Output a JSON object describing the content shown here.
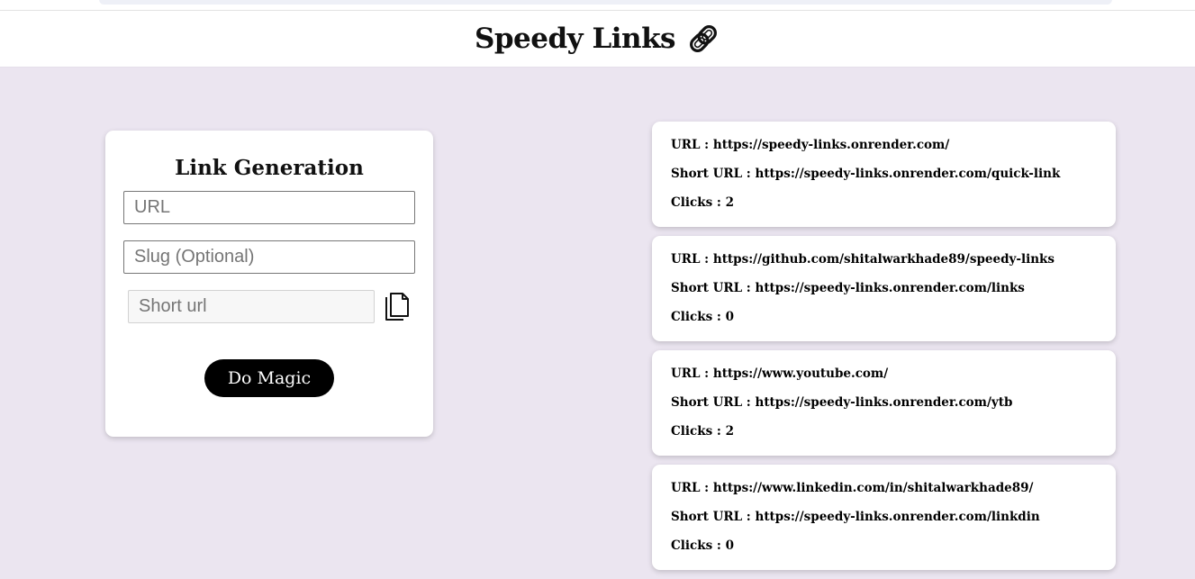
{
  "header": {
    "title": "Speedy Links",
    "icon": "link-icon"
  },
  "form": {
    "title": "Link Generation",
    "url_placeholder": "URL",
    "slug_placeholder": "Slug (Optional)",
    "short_placeholder": "Short url",
    "copy_icon": "copy-icon",
    "submit_label": "Do Magic"
  },
  "labels": {
    "url": "URL : ",
    "short_url": "Short URL : ",
    "clicks": "Clicks : "
  },
  "links": [
    {
      "url": "https://speedy-links.onrender.com/",
      "short_url": "https://speedy-links.onrender.com/quick-link",
      "clicks": "2"
    },
    {
      "url": "https://github.com/shitalwarkhade89/speedy-links",
      "short_url": "https://speedy-links.onrender.com/links",
      "clicks": "0"
    },
    {
      "url": "https://www.youtube.com/",
      "short_url": "https://speedy-links.onrender.com/ytb",
      "clicks": "2"
    },
    {
      "url": "https://www.linkedin.com/in/shitalwarkhade89/",
      "short_url": "https://speedy-links.onrender.com/linkdin",
      "clicks": "0"
    }
  ]
}
